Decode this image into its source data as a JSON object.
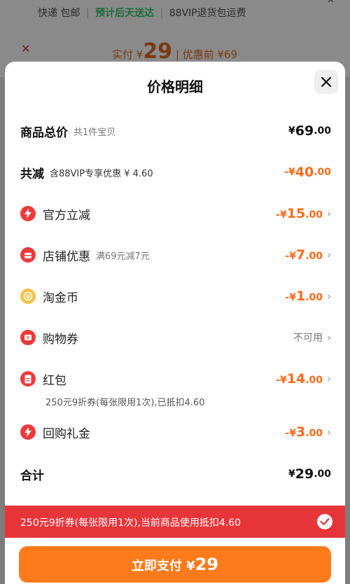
{
  "background": {
    "delivery_left": "快递 包邮",
    "delivery_estimate": "预计后天送达",
    "delivery_right": "88VIP退货包运费",
    "paid_label": "实付 ¥",
    "paid_amount": "29",
    "before_label": "优惠前 ¥69"
  },
  "sheet": {
    "title": "价格明细",
    "rows": {
      "total": {
        "label": "商品总价",
        "sub": "共1件宝贝",
        "cur": "¥",
        "int": "69",
        "dec": ".00"
      },
      "reduce": {
        "label": "共减",
        "sub": "含88VIP专享优惠 ¥ 4.60",
        "cur": "-¥",
        "int": "40",
        "dec": ".00"
      },
      "official": {
        "label": "官方立减",
        "cur": "-¥",
        "int": "15",
        "dec": ".00"
      },
      "shop": {
        "label": "店铺优惠",
        "sub": "满69元减7元",
        "cur": "-¥",
        "int": "7",
        "dec": ".00"
      },
      "coins": {
        "label": "淘金币",
        "cur": "-¥",
        "int": "1",
        "dec": ".00"
      },
      "voucher": {
        "label": "购物券",
        "status": "不可用"
      },
      "redpack": {
        "label": "红包",
        "cur": "-¥",
        "int": "14",
        "dec": ".00",
        "note": "250元9折券(每张限用1次),已抵扣4.60"
      },
      "cashback": {
        "label": "回购礼金",
        "cur": "-¥",
        "int": "3",
        "dec": ".00"
      },
      "sum": {
        "label": "合计",
        "cur": "¥",
        "int": "29",
        "dec": ".00"
      }
    }
  },
  "coupon_bar": {
    "text": "250元9折券(每张限用1次),当前商品使用抵扣4.60"
  },
  "pay_button": {
    "label": "立即支付 ¥",
    "amount": "29"
  },
  "colors": {
    "accent": "#ff6a1a",
    "red": "#e8353a",
    "gold": "#f6c14a"
  }
}
